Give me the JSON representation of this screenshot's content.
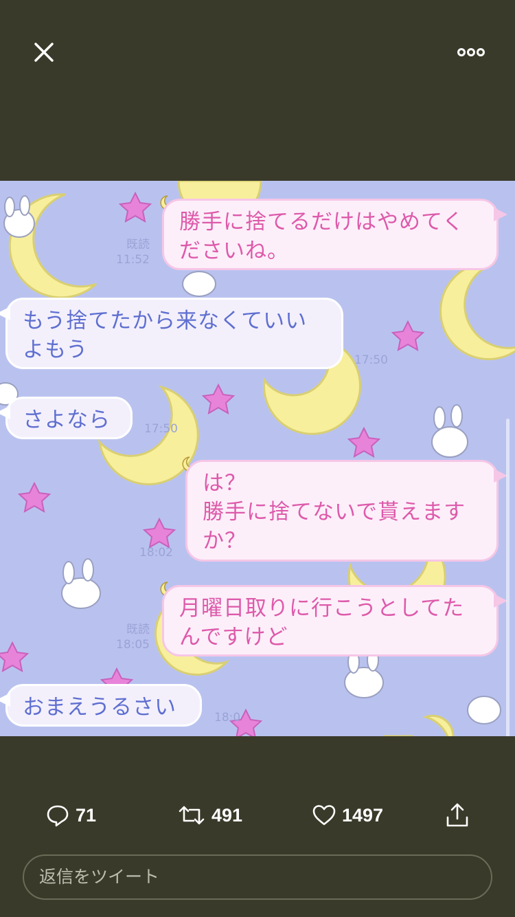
{
  "viewer": {
    "close_icon": "close-icon",
    "more_icon": "more-dots-icon"
  },
  "chat": {
    "messages": [
      {
        "side": "right",
        "text": "勝手に捨てるだけはやめてく\nださいね。",
        "read": "既読",
        "time": "11:52"
      },
      {
        "side": "left",
        "text": "もう捨てたから来なくていい\nよもう",
        "time": "17:50"
      },
      {
        "side": "left",
        "text": "さよなら",
        "time": "17:50"
      },
      {
        "side": "right",
        "text": "は？\n勝手に捨てないで貰えます\nか？",
        "time": "18:02"
      },
      {
        "side": "right",
        "text": "月曜日取りに行こうとしてた\nんですけど",
        "read": "既読",
        "time": "18:05"
      },
      {
        "side": "left",
        "text": "おまえうるさい",
        "time": "18:0"
      }
    ]
  },
  "actions": {
    "reply": {
      "icon": "reply-icon",
      "count": "71"
    },
    "retweet": {
      "icon": "retweet-icon",
      "count": "491"
    },
    "like": {
      "icon": "heart-icon",
      "count": "1497"
    },
    "share": {
      "icon": "share-icon"
    }
  },
  "reply_field": {
    "placeholder": "返信をツイート"
  },
  "colors": {
    "viewer_background": "#3a3a2a",
    "chat_background": "#b9c2ef",
    "right_bubble_text": "#dd5aaa",
    "left_bubble_text": "#5f6fd0"
  }
}
